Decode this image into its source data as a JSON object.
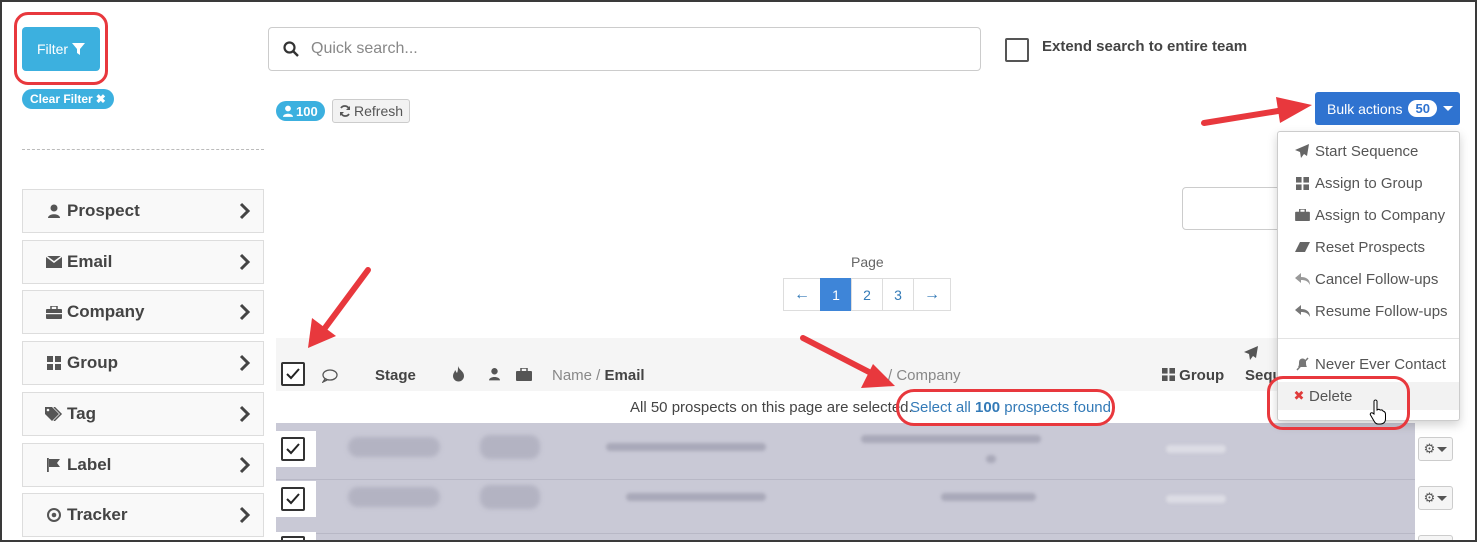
{
  "sidebar": {
    "filter_label": "Filter",
    "clear_filter_label": "Clear Filter",
    "items": [
      {
        "label": "Prospect",
        "icon": "user-icon"
      },
      {
        "label": "Email",
        "icon": "envelope-icon"
      },
      {
        "label": "Company",
        "icon": "briefcase-icon"
      },
      {
        "label": "Group",
        "icon": "grid-icon"
      },
      {
        "label": "Tag",
        "icon": "tags-icon"
      },
      {
        "label": "Label",
        "icon": "flag-icon"
      },
      {
        "label": "Tracker",
        "icon": "target-icon"
      }
    ]
  },
  "search": {
    "placeholder": "Quick search...",
    "extend_label": "Extend search to entire team"
  },
  "toolbar": {
    "count": "100",
    "refresh_label": "Refresh"
  },
  "bulk": {
    "label": "Bulk actions",
    "count": "50",
    "menu": [
      {
        "label": "Start Sequence",
        "icon": "paper-plane-icon"
      },
      {
        "label": "Assign to Group",
        "icon": "grid-icon"
      },
      {
        "label": "Assign to Company",
        "icon": "briefcase-icon"
      },
      {
        "label": "Reset Prospects",
        "icon": "eraser-icon"
      },
      {
        "label": "Cancel Follow-ups",
        "icon": "reply-icon"
      },
      {
        "label": "Resume Follow-ups",
        "icon": "reply-all-icon"
      },
      {
        "label": "Never Ever Contact",
        "icon": "mute-icon"
      },
      {
        "label": "Delete",
        "icon": "x-icon"
      }
    ]
  },
  "pagination": {
    "label": "Page",
    "prev": "←",
    "next": "→",
    "pages": [
      "1",
      "2",
      "3"
    ],
    "current": "1"
  },
  "table": {
    "headers": {
      "stage": "Stage",
      "name": "Name / ",
      "email": "Email",
      "company": "/ Company",
      "group": "Group",
      "sequence": "Sequ"
    },
    "selection_text": "All 50 prospects on this page are selected.",
    "select_all_prefix": "Select all ",
    "select_all_count": "100",
    "select_all_suffix": " prospects found"
  },
  "colors": {
    "filter_blue": "#3cb0df",
    "bulk_blue": "#2f73d0",
    "annotation_red": "#e8383d",
    "delete_red": "#e03b3b"
  }
}
